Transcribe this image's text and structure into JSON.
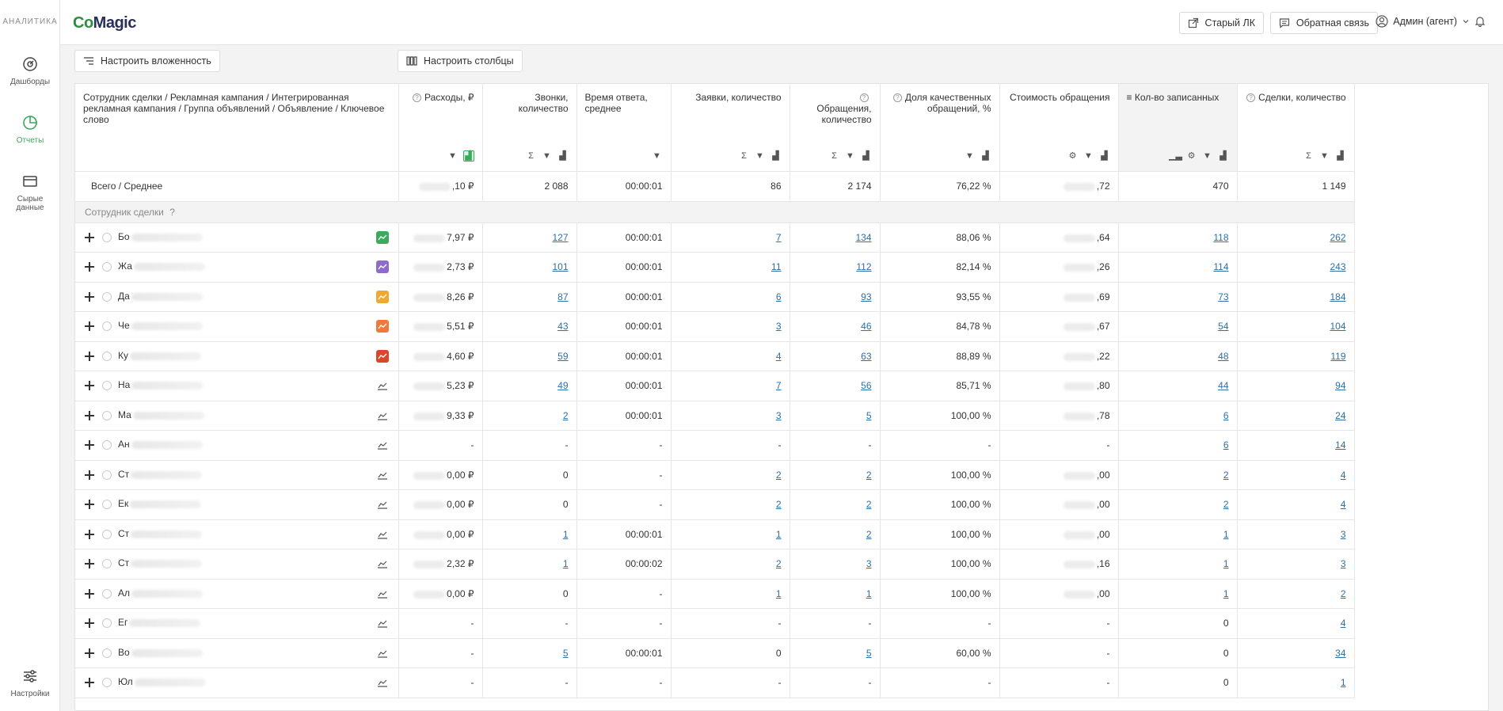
{
  "sidebar": {
    "brand_label": "АНАЛИТИКА",
    "items": [
      {
        "label": "Дашборды",
        "icon": "dashboard-icon"
      },
      {
        "label": "Отчеты",
        "icon": "reports-icon"
      },
      {
        "label": "Сырые данные",
        "icon": "raw-data-icon"
      },
      {
        "label": "Настройки",
        "icon": "settings-icon"
      }
    ]
  },
  "topbar": {
    "logo_a": "Co",
    "logo_b": "Magic",
    "old_lk": "Старый ЛК",
    "feedback": "Обратная связь",
    "user": "Админ (агент)"
  },
  "toolbar": {
    "nesting": "Настроить вложенность",
    "columns": "Настроить столбцы"
  },
  "table": {
    "headers": [
      "Сотрудник сделки / Рекламная кампания / Интегрированная рекламная кампания / Группа объявлений / Объявление / Ключевое слово",
      "Расходы, ₽",
      "Звонки, количество",
      "Время ответа, среднее",
      "Заявки, количество",
      "Обращения, количество",
      "Доля качественных обращений, %",
      "Стоимость обращения",
      "Кол-во записанных",
      "Сделки, количество"
    ],
    "total": {
      "label": "Всего / Среднее",
      "cells": [
        ",10 ₽",
        "2 088",
        "00:00:01",
        "86",
        "2 174",
        "76,22 %",
        ",72",
        "470",
        "1 149"
      ]
    },
    "group_label": "Сотрудник сделки",
    "rows": [
      {
        "name": "Бо",
        "spark": "#3aaa5c",
        "cells": [
          "7,97 ₽",
          "127",
          "00:00:01",
          "7",
          "134",
          "88,06 %",
          ",64",
          "118",
          "262"
        ]
      },
      {
        "name": "Жа",
        "spark": "#8e6bc9",
        "cells": [
          "2,73 ₽",
          "101",
          "00:00:01",
          "11",
          "112",
          "82,14 %",
          ",26",
          "114",
          "243"
        ]
      },
      {
        "name": "Да",
        "spark": "#f0a830",
        "cells": [
          "8,26 ₽",
          "87",
          "00:00:01",
          "6",
          "93",
          "93,55 %",
          ",69",
          "73",
          "184"
        ]
      },
      {
        "name": "Че",
        "spark": "#ef7a3a",
        "cells": [
          "5,51 ₽",
          "43",
          "00:00:01",
          "3",
          "46",
          "84,78 %",
          ",67",
          "54",
          "104"
        ]
      },
      {
        "name": "Ку",
        "spark": "#d9462b",
        "cells": [
          "4,60 ₽",
          "59",
          "00:00:01",
          "4",
          "63",
          "88,89 %",
          ",22",
          "48",
          "119"
        ]
      },
      {
        "name": "На",
        "spark": "",
        "cells": [
          "5,23 ₽",
          "49",
          "00:00:01",
          "7",
          "56",
          "85,71 %",
          ",80",
          "44",
          "94"
        ]
      },
      {
        "name": "Ма",
        "spark": "",
        "cells": [
          "9,33 ₽",
          "2",
          "00:00:01",
          "3",
          "5",
          "100,00 %",
          ",78",
          "6",
          "24"
        ]
      },
      {
        "name": "Ан",
        "spark": "",
        "cells": [
          "-",
          "-",
          "-",
          "-",
          "-",
          "-",
          "-",
          "6",
          "14"
        ]
      },
      {
        "name": "Ст",
        "spark": "",
        "cells": [
          "0,00 ₽",
          "0",
          "-",
          "2",
          "2",
          "100,00 %",
          ",00",
          "2",
          "4"
        ]
      },
      {
        "name": "Ек",
        "spark": "",
        "cells": [
          "0,00 ₽",
          "0",
          "-",
          "2",
          "2",
          "100,00 %",
          ",00",
          "2",
          "4"
        ]
      },
      {
        "name": "Ст",
        "spark": "",
        "cells": [
          "0,00 ₽",
          "1",
          "00:00:01",
          "1",
          "2",
          "100,00 %",
          ",00",
          "1",
          "3"
        ]
      },
      {
        "name": "Ст",
        "spark": "",
        "cells": [
          "2,32 ₽",
          "1",
          "00:00:02",
          "2",
          "3",
          "100,00 %",
          ",16",
          "1",
          "3"
        ]
      },
      {
        "name": "Ал",
        "spark": "",
        "cells": [
          "0,00 ₽",
          "0",
          "-",
          "1",
          "1",
          "100,00 %",
          ",00",
          "1",
          "2"
        ]
      },
      {
        "name": "Ег",
        "spark": "",
        "cells": [
          "-",
          "-",
          "-",
          "-",
          "-",
          "-",
          "-",
          "0",
          "4"
        ]
      },
      {
        "name": "Во",
        "spark": "",
        "cells": [
          "-",
          "5",
          "00:00:01",
          "0",
          "5",
          "60,00 %",
          "-",
          "0",
          "34"
        ]
      },
      {
        "name": "Юл",
        "spark": "",
        "cells": [
          "-",
          "-",
          "-",
          "-",
          "-",
          "-",
          "-",
          "0",
          "1"
        ]
      }
    ]
  }
}
